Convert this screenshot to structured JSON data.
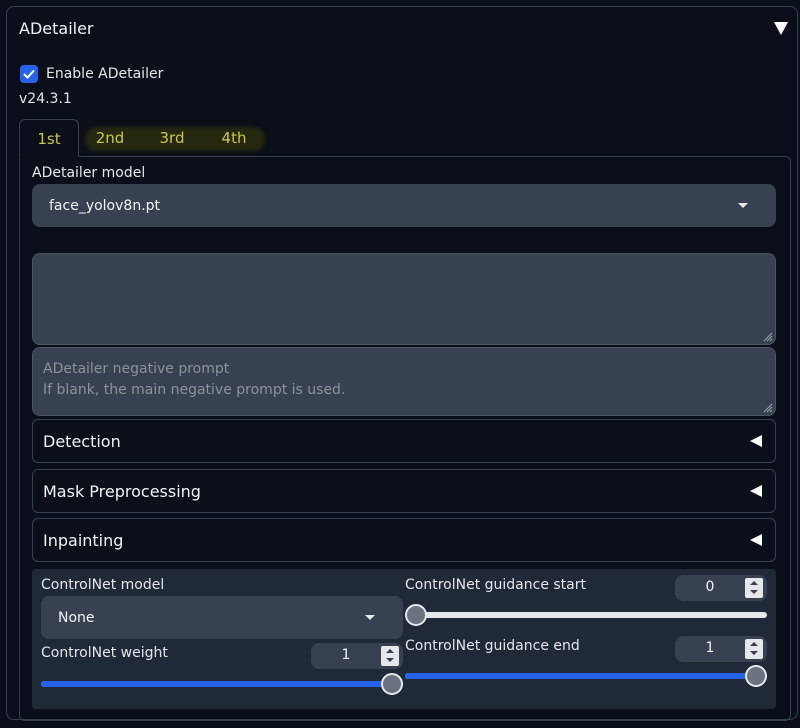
{
  "panel": {
    "title": "ADetailer"
  },
  "enable": {
    "label": "Enable ADetailer",
    "checked": true
  },
  "version": "v24.3.1",
  "tabs": [
    {
      "label": "1st",
      "active": true
    },
    {
      "label": "2nd",
      "active": false
    },
    {
      "label": "3rd",
      "active": false
    },
    {
      "label": "4th",
      "active": false
    }
  ],
  "model": {
    "label": "ADetailer model",
    "value": "face_yolov8n.pt"
  },
  "prompt": {
    "value": ""
  },
  "negative_prompt": {
    "placeholder_line1": "ADetailer negative prompt",
    "placeholder_line2": "If blank, the main negative prompt is used."
  },
  "sections": [
    {
      "label": "Detection"
    },
    {
      "label": "Mask Preprocessing"
    },
    {
      "label": "Inpainting"
    }
  ],
  "controlnet": {
    "model_label": "ControlNet model",
    "model_value": "None",
    "weight_label": "ControlNet weight",
    "weight_value": "1",
    "weight_fraction": 1.0,
    "guidance_start_label": "ControlNet guidance start",
    "guidance_start_value": "0",
    "guidance_start_fraction": 0.0,
    "guidance_end_label": "ControlNet guidance end",
    "guidance_end_value": "1",
    "guidance_end_fraction": 1.0
  },
  "colors": {
    "accent": "#2563eb",
    "tab_text": "#c9c947",
    "background": "#0b0f19",
    "input_bg": "#374151"
  }
}
